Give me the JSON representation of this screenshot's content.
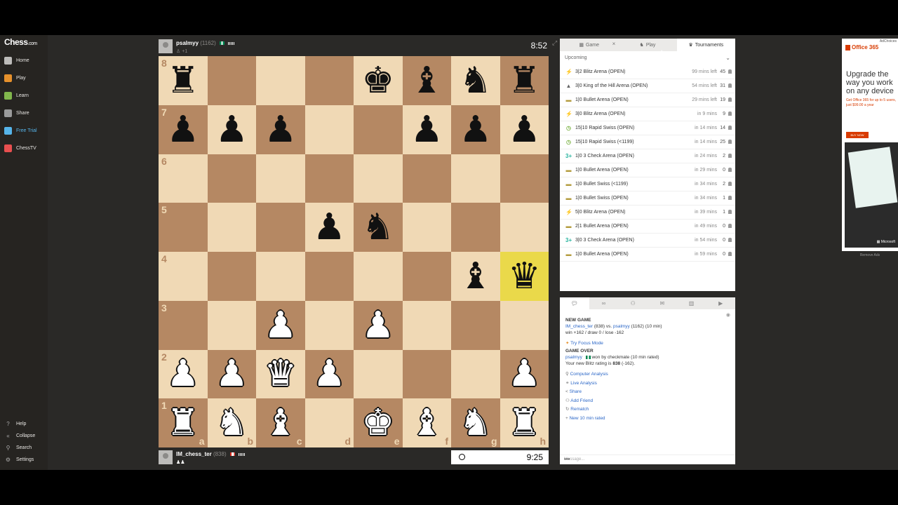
{
  "sidebar": {
    "logo": "Chess",
    "logo_suffix": ".com",
    "nav": [
      {
        "label": "Home",
        "icon": "home-icon",
        "color": "#bdbcba"
      },
      {
        "label": "Play",
        "icon": "play-icon",
        "color": "#e6912c"
      },
      {
        "label": "Learn",
        "icon": "learn-icon",
        "color": "#81b64c"
      },
      {
        "label": "Share",
        "icon": "share-icon",
        "color": "#9b9b9b"
      },
      {
        "label": "Free Trial",
        "icon": "diamond-icon",
        "color": "#56b4e9"
      },
      {
        "label": "ChessTV",
        "icon": "tv-icon",
        "color": "#e84f4f"
      }
    ],
    "bottom": [
      {
        "label": "Help",
        "icon": "help-icon"
      },
      {
        "label": "Collapse",
        "icon": "collapse-icon"
      },
      {
        "label": "Search",
        "icon": "search-icon"
      },
      {
        "label": "Settings",
        "icon": "gear-icon"
      }
    ]
  },
  "top_player": {
    "name": "psalmyy",
    "rating": "(1162)",
    "sub": "+1",
    "clock": "8:52"
  },
  "bottom_player": {
    "name": "IM_chess_ter",
    "rating": "(838)",
    "clock": "9:25"
  },
  "board": {
    "rows": [
      [
        "br",
        "",
        "",
        "",
        "bk",
        "bb",
        "bn",
        "br"
      ],
      [
        "bp",
        "bp",
        "bp",
        "",
        "",
        "bp",
        "bp",
        "bp"
      ],
      [
        "",
        "",
        "",
        "",
        "",
        "",
        "",
        ""
      ],
      [
        "",
        "",
        "",
        "bp",
        "bn",
        "",
        "",
        ""
      ],
      [
        "",
        "",
        "",
        "",
        "",
        "",
        "bb",
        "bq"
      ],
      [
        "",
        "",
        "wp",
        "",
        "wp",
        "",
        "",
        ""
      ],
      [
        "wp",
        "wp",
        "wq",
        "wp",
        "",
        "",
        "",
        "wp"
      ],
      [
        "wr",
        "wn",
        "wb",
        "",
        "wk",
        "wb",
        "wn",
        "wr"
      ]
    ],
    "highlight": [
      [
        4,
        7
      ]
    ],
    "ranks": [
      "8",
      "7",
      "6",
      "5",
      "4",
      "3",
      "2",
      "1"
    ],
    "files": [
      "a",
      "b",
      "c",
      "d",
      "e",
      "f",
      "g",
      "h"
    ]
  },
  "tabs": [
    {
      "label": "Game",
      "icon": "board-icon"
    },
    {
      "label": "Play",
      "icon": "play-icon"
    },
    {
      "label": "Tournaments",
      "icon": "trophy-icon"
    }
  ],
  "upcoming_label": "Upcoming",
  "tournaments": [
    {
      "name": "3|2 Blitz Arena (OPEN)",
      "time": "99 mins left",
      "count": "45",
      "icon": "blitz-icon",
      "glyph": "⚡",
      "color": "#e6b422"
    },
    {
      "name": "3|0 King of the Hill Arena (OPEN)",
      "time": "54 mins left",
      "count": "31",
      "icon": "hill-icon",
      "glyph": "▲",
      "color": "#666666"
    },
    {
      "name": "1|0 Bullet Arena (OPEN)",
      "time": "29 mins left",
      "count": "19",
      "icon": "bullet-icon",
      "glyph": "▬",
      "color": "#b39b3d"
    },
    {
      "name": "3|0 Blitz Arena (OPEN)",
      "time": "in 9 mins",
      "count": "9",
      "icon": "blitz-icon",
      "glyph": "⚡",
      "color": "#e6b422"
    },
    {
      "name": "15|10 Rapid Swiss (OPEN)",
      "time": "in 14 mins",
      "count": "14",
      "icon": "rapid-icon",
      "glyph": "◷",
      "color": "#81b64c"
    },
    {
      "name": "15|10 Rapid Swiss (<1199)",
      "time": "in 14 mins",
      "count": "25",
      "icon": "rapid-icon",
      "glyph": "◷",
      "color": "#81b64c"
    },
    {
      "name": "1|0 3 Check Arena (OPEN)",
      "time": "in 24 mins",
      "count": "2",
      "icon": "threecheck-icon",
      "glyph": "3+",
      "color": "#2bb5a0"
    },
    {
      "name": "1|0 Bullet Arena (OPEN)",
      "time": "in 29 mins",
      "count": "0",
      "icon": "bullet-icon",
      "glyph": "▬",
      "color": "#b39b3d"
    },
    {
      "name": "1|0 Bullet Swiss (<1199)",
      "time": "in 34 mins",
      "count": "2",
      "icon": "bullet-icon",
      "glyph": "▬",
      "color": "#b39b3d"
    },
    {
      "name": "1|0 Bullet Swiss (OPEN)",
      "time": "in 34 mins",
      "count": "1",
      "icon": "bullet-icon",
      "glyph": "▬",
      "color": "#b39b3d"
    },
    {
      "name": "5|0 Blitz Arena (OPEN)",
      "time": "in 39 mins",
      "count": "1",
      "icon": "blitz-icon",
      "glyph": "⚡",
      "color": "#e6b422"
    },
    {
      "name": "2|1 Bullet Arena (OPEN)",
      "time": "in 49 mins",
      "count": "0",
      "icon": "bullet-icon",
      "glyph": "▬",
      "color": "#b39b3d"
    },
    {
      "name": "3|0 3 Check Arena (OPEN)",
      "time": "in 54 mins",
      "count": "0",
      "icon": "threecheck-icon",
      "glyph": "3+",
      "color": "#2bb5a0"
    },
    {
      "name": "1|0 Bullet Arena (OPEN)",
      "time": "in 59 mins",
      "count": "0",
      "icon": "bullet-icon",
      "glyph": "▬",
      "color": "#b39b3d"
    }
  ],
  "chat": {
    "new_game_header": "NEW GAME",
    "player_white": "IM_chess_ter",
    "player_white_rating": "(838)",
    "vs": "vs.",
    "player_black": "psalmyy",
    "player_black_rating": "(1162) (10 min)",
    "stakes": "win +162 / draw 0 / lose -162",
    "focus_mode": "Try Focus Mode",
    "game_over_header": "GAME OVER",
    "winner": "psalmyy",
    "result_text": "won by checkmate (10 min rated)",
    "rating_text_prefix": "Your new Blitz rating is",
    "rating_value": "838",
    "rating_change": "(-162).",
    "actions": [
      {
        "label": "Computer Analysis",
        "icon": "analysis-icon",
        "glyph": "⚲"
      },
      {
        "label": "Live Analysis",
        "icon": "live-analysis-icon",
        "glyph": "⚭"
      },
      {
        "label": "Share",
        "icon": "share-icon",
        "glyph": "<"
      },
      {
        "label": "Add Friend",
        "icon": "add-friend-icon",
        "glyph": "⚇"
      },
      {
        "label": "Rematch",
        "icon": "rematch-icon",
        "glyph": "↻"
      },
      {
        "label": "New 10 min rated",
        "icon": "plus-icon",
        "glyph": "+"
      }
    ],
    "message_placeholder": "Message..."
  },
  "ad": {
    "adchoices": "AdChoices",
    "brand": "Office 365",
    "headline": "Upgrade the way you work on any device",
    "sub": "Get Office 365 for up to 5 users, just $99.00 a year",
    "buy": "BUY NOW",
    "footer": "Microsoft",
    "remove": "Remove Ads"
  }
}
